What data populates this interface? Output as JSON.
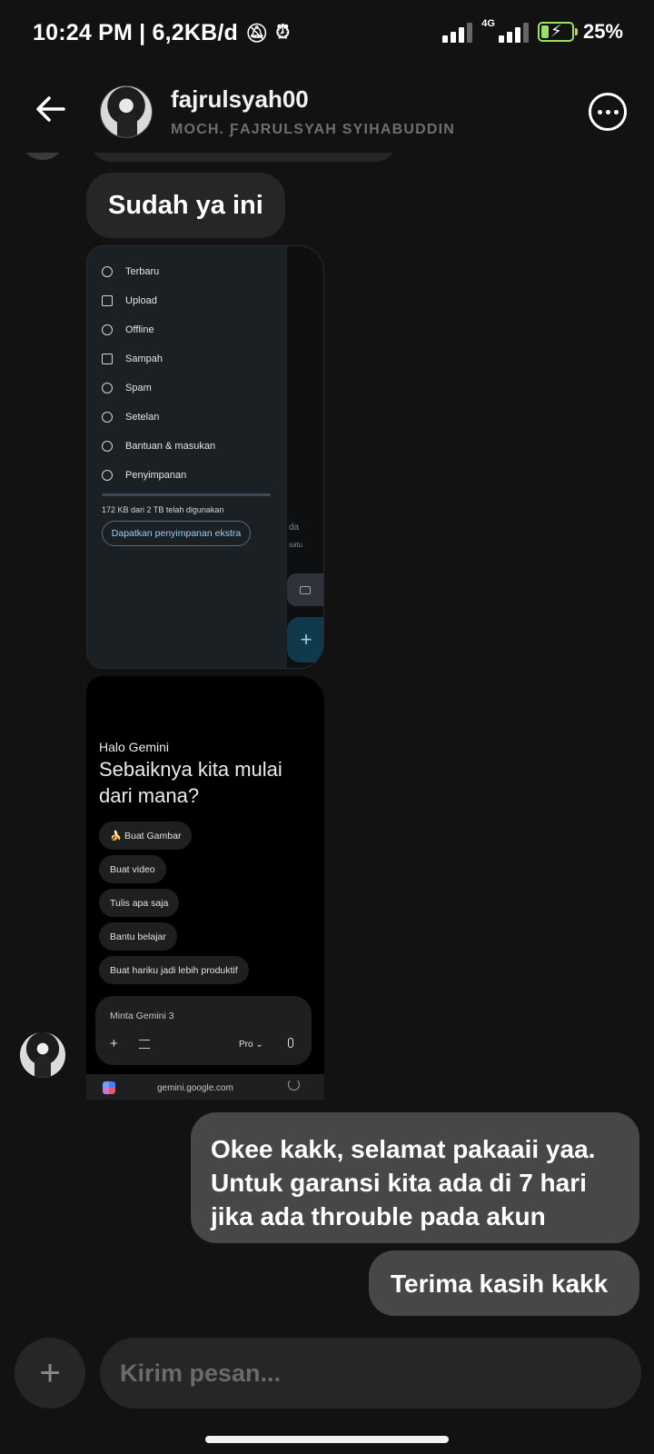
{
  "status_bar": {
    "time_info": "10:24 PM | 6,2KB/d",
    "network": "4G",
    "battery": "25%",
    "battery_level": 0.25
  },
  "header": {
    "username": "fajrulsyah00",
    "full_name": "MOCH. ƑAJRULSYAH SYIHABUDDIN"
  },
  "messages": {
    "in_1": "Sudah ya ini",
    "out_1_line1": "Okee kakk, selamat pakaaii yaa.",
    "out_1_line2": "Untuk garansi kita ada di 7 hari",
    "out_1_line3": "jika ada throuble pada akun",
    "out_2": "Terima kasih kakk"
  },
  "image1": {
    "menu_items": [
      "Terbaru",
      "Upload",
      "Offline",
      "Sampah",
      "Spam",
      "Setelan",
      "Bantuan & masukan",
      "Penyimpanan"
    ],
    "storage_text": "172 KB dari 2 TB telah digunakan",
    "storage_button": "Dapatkan penyimpanan ekstra",
    "bg_text1": "da",
    "bg_text2": "satu"
  },
  "image2": {
    "greeting": "Halo Gemini",
    "title": "Sebaiknya kita mulai dari mana?",
    "chips": [
      "🍌 Buat Gambar",
      "Buat video",
      "Tulis apa saja",
      "Bantu belajar",
      "Buat hariku jadi lebih produktif"
    ],
    "input_placeholder": "Minta Gemini 3",
    "model": "Pro ⌄",
    "url": "gemini.google.com"
  },
  "composer": {
    "placeholder": "Kirim pesan..."
  },
  "colors": {
    "background": "#121212",
    "bubble_in": "#262626",
    "bubble_out": "#474747",
    "battery": "#9be15d"
  }
}
